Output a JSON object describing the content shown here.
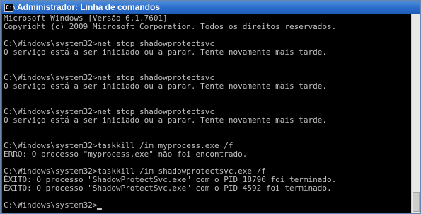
{
  "window": {
    "title": "Administrador: Linha de comandos",
    "icon": "cmd-icon",
    "icon_glyph": "C:\\"
  },
  "console": {
    "lines": [
      "Microsoft Windows [Versão 6.1.7601]",
      "Copyright (c) 2009 Microsoft Corporation. Todos os direitos reservados.",
      "",
      "C:\\Windows\\system32>net stop shadowprotectsvc",
      "O serviço está a ser iniciado ou a parar. Tente novamente mais tarde.",
      "",
      "",
      "C:\\Windows\\system32>net stop shadowprotectsvc",
      "O serviço está a ser iniciado ou a parar. Tente novamente mais tarde.",
      "",
      "",
      "C:\\Windows\\system32>net stop shadowprotectsvc",
      "O serviço está a ser iniciado ou a parar. Tente novamente mais tarde.",
      "",
      "",
      "C:\\Windows\\system32>taskkill /im myprocess.exe /f",
      "ERRO: O processo \"myprocess.exe\" não foi encontrado.",
      "",
      "C:\\Windows\\system32>taskkill /im shadowprotectsvc.exe /f",
      "ÊXITO: O processo \"ShadowProtectSvc.exe\" com o PID 18796 foi terminado.",
      "ÊXITO: O processo \"ShadowProtectSvc.exe\" com o PID 4592 foi terminado.",
      "",
      "C:\\Windows\\system32>"
    ]
  }
}
